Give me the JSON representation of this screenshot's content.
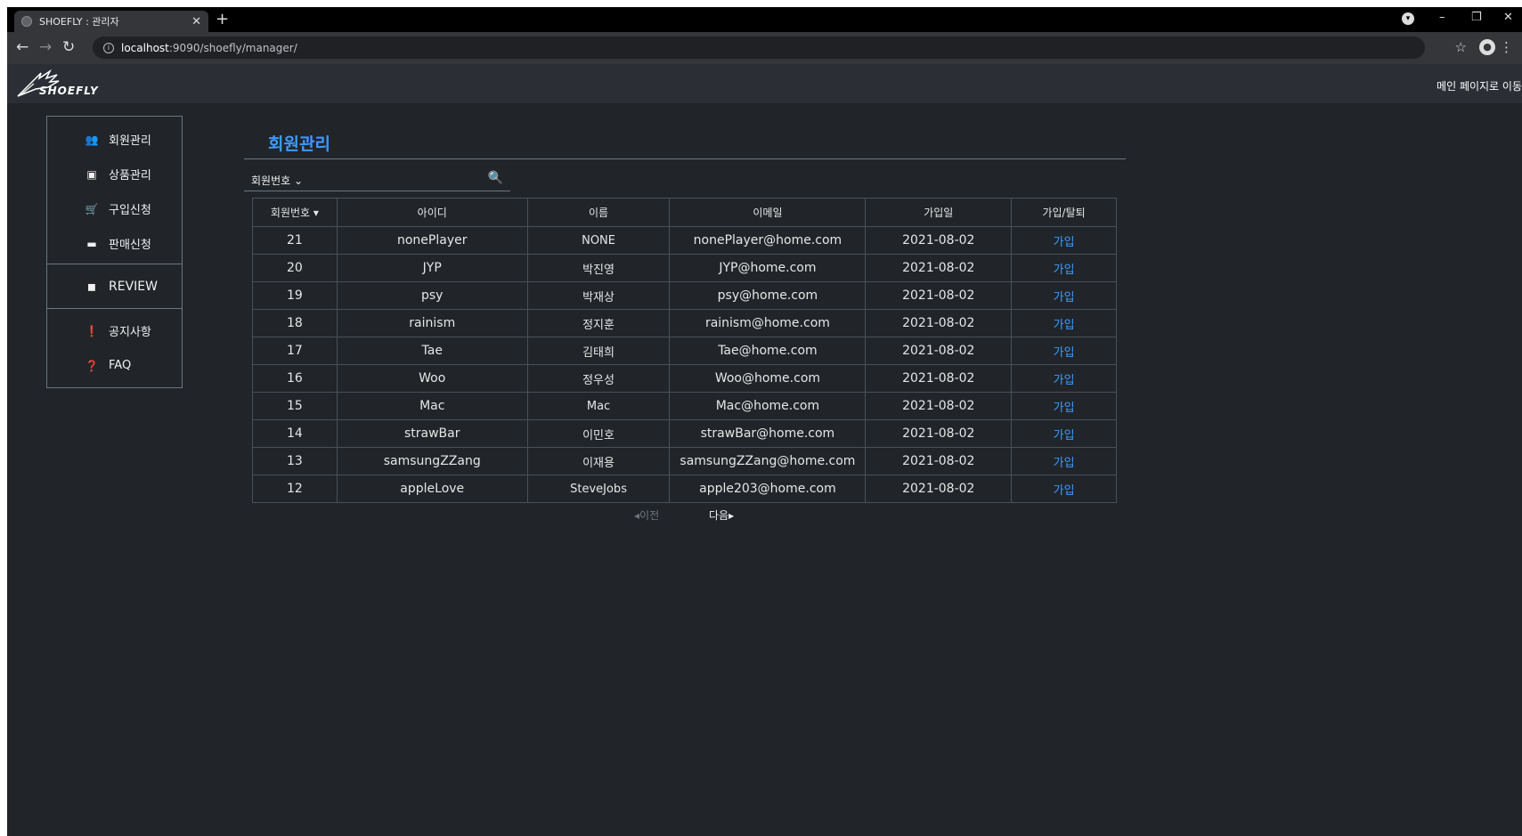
{
  "browser": {
    "tab_title": "SHOEFLY : 관리자",
    "url_host": "localhost",
    "url_rest": ":9090/shoefly/manager/"
  },
  "header": {
    "logo_text": "SHOEFLY",
    "to_main_link": "메인 페이지로 이동"
  },
  "sidebar": {
    "items": [
      {
        "label": "회원관리",
        "icon": "users-icon"
      },
      {
        "label": "상품관리",
        "icon": "gift-icon"
      },
      {
        "label": "구입신청",
        "icon": "cart-icon"
      },
      {
        "label": "판매신청",
        "icon": "money-icon"
      },
      {
        "label": "REVIEW",
        "icon": "note-icon"
      },
      {
        "label": "공지사항",
        "icon": "exclamation-icon"
      },
      {
        "label": "FAQ",
        "icon": "question-icon"
      }
    ]
  },
  "main": {
    "title": "회원관리",
    "search_select": "회원번호 ⌄"
  },
  "table": {
    "headers": [
      "회원번호 ▾",
      "아이디",
      "이름",
      "이메일",
      "가입일",
      "가입/탈퇴"
    ],
    "rows": [
      [
        "21",
        "nonePlayer",
        "NONE",
        "nonePlayer@home.com",
        "2021-08-02",
        "가입"
      ],
      [
        "20",
        "JYP",
        "박진영",
        "JYP@home.com",
        "2021-08-02",
        "가입"
      ],
      [
        "19",
        "psy",
        "박재상",
        "psy@home.com",
        "2021-08-02",
        "가입"
      ],
      [
        "18",
        "rainism",
        "정지훈",
        "rainism@home.com",
        "2021-08-02",
        "가입"
      ],
      [
        "17",
        "Tae",
        "김태희",
        "Tae@home.com",
        "2021-08-02",
        "가입"
      ],
      [
        "16",
        "Woo",
        "정우성",
        "Woo@home.com",
        "2021-08-02",
        "가입"
      ],
      [
        "15",
        "Mac",
        "Mac",
        "Mac@home.com",
        "2021-08-02",
        "가입"
      ],
      [
        "14",
        "strawBar",
        "이민호",
        "strawBar@home.com",
        "2021-08-02",
        "가입"
      ],
      [
        "13",
        "samsungZZang",
        "이재용",
        "samsungZZang@home.com",
        "2021-08-02",
        "가입"
      ],
      [
        "12",
        "appleLove",
        "SteveJobs",
        "apple203@home.com",
        "2021-08-02",
        "가입"
      ]
    ]
  },
  "pager": {
    "prev": "◂이전",
    "next": "다음▸"
  },
  "colors": {
    "accent": "#3d9bff",
    "background": "#212529",
    "border": "#495057"
  }
}
